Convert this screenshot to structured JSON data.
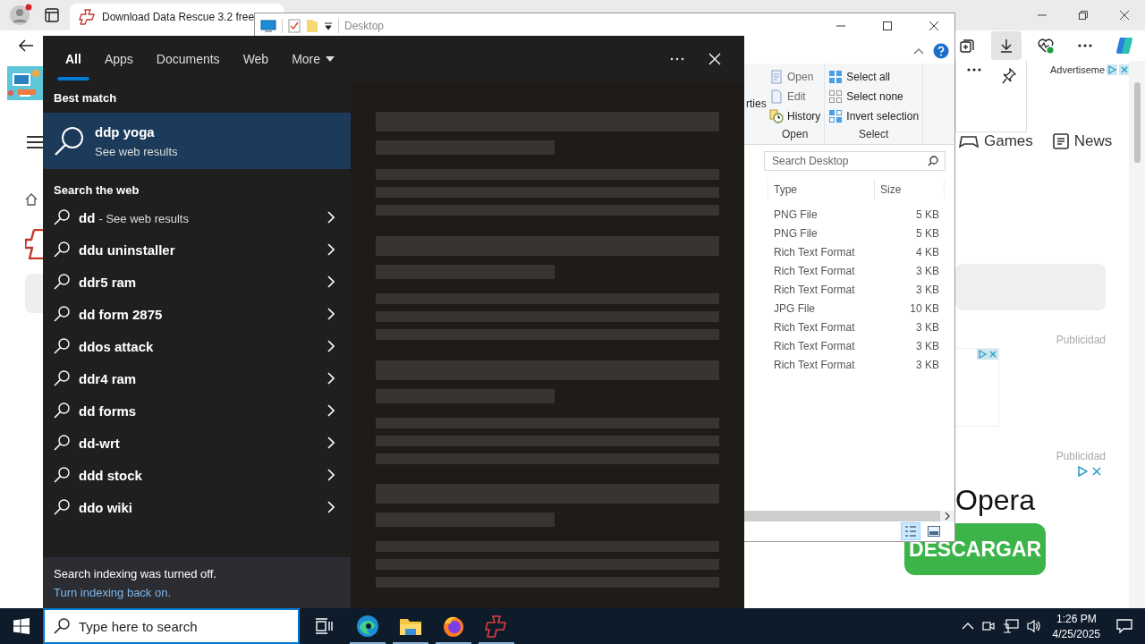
{
  "browser": {
    "tab": {
      "title": "Download Data Rescue 3.2 free"
    },
    "toolbar_buttons": [
      {
        "kind": "collections",
        "selected": false
      },
      {
        "kind": "downloads",
        "selected": true
      },
      {
        "kind": "health",
        "selected": false
      },
      {
        "kind": "more",
        "selected": false
      },
      {
        "kind": "copilot",
        "selected": false
      }
    ],
    "page": {
      "ad_label": "Advertiseme",
      "nav": [
        {
          "kind": "games",
          "label": "Games"
        },
        {
          "kind": "news",
          "label": "News"
        }
      ],
      "sponsor_labels": [
        "Publicidad",
        "Publicidad"
      ],
      "ad_brand": "Opera",
      "download_button": "DESCARGAR"
    }
  },
  "explorer": {
    "location": "Desktop",
    "ribbon": {
      "cut_label": "rties",
      "groups": [
        {
          "name": "Open",
          "items": [
            {
              "kind": "open",
              "label": "Open",
              "disabled": true
            },
            {
              "kind": "edit",
              "label": "Edit",
              "disabled": true
            },
            {
              "kind": "history",
              "label": "History",
              "disabled": false
            }
          ]
        },
        {
          "name": "Select",
          "items": [
            {
              "kind": "select-all",
              "label": "Select all",
              "disabled": false
            },
            {
              "kind": "select-none",
              "label": "Select none",
              "disabled": false
            },
            {
              "kind": "invert",
              "label": "Invert selection",
              "disabled": false
            }
          ]
        }
      ]
    },
    "search": {
      "placeholder": "Search Desktop"
    },
    "columns": [
      "Type",
      "Size"
    ],
    "rows": [
      {
        "type": "PNG File",
        "size": "5 KB"
      },
      {
        "type": "PNG File",
        "size": "5 KB"
      },
      {
        "type": "Rich Text Format",
        "size": "4 KB"
      },
      {
        "type": "Rich Text Format",
        "size": "3 KB"
      },
      {
        "type": "Rich Text Format",
        "size": "3 KB"
      },
      {
        "type": "JPG File",
        "size": "10 KB"
      },
      {
        "type": "Rich Text Format",
        "size": "3 KB"
      },
      {
        "type": "Rich Text Format",
        "size": "3 KB"
      },
      {
        "type": "Rich Text Format",
        "size": "3 KB"
      }
    ]
  },
  "search_panel": {
    "tabs": [
      {
        "label": "All",
        "selected": true,
        "dropdown": false
      },
      {
        "label": "Apps",
        "selected": false,
        "dropdown": false
      },
      {
        "label": "Documents",
        "selected": false,
        "dropdown": false
      },
      {
        "label": "Web",
        "selected": false,
        "dropdown": false
      },
      {
        "label": "More",
        "selected": false,
        "dropdown": true
      }
    ],
    "best_match": {
      "heading": "Best match",
      "title": "ddp yoga",
      "subtitle": "See web results"
    },
    "web_heading": "Search the web",
    "suggestions": [
      {
        "query": "dd",
        "hint": "- See web results"
      },
      {
        "query": "ddu uninstaller"
      },
      {
        "query": "ddr5 ram"
      },
      {
        "query": "dd form 2875"
      },
      {
        "query": "ddos attack"
      },
      {
        "query": "ddr4 ram"
      },
      {
        "query": "dd forms"
      },
      {
        "query": "dd-wrt"
      },
      {
        "query": "ddd stock"
      },
      {
        "query": "ddo wiki"
      }
    ],
    "notice": {
      "text": "Search indexing was turned off.",
      "link": "Turn indexing back on."
    }
  },
  "taskbar": {
    "search_placeholder": "Type here to search",
    "apps": [
      {
        "kind": "task-view",
        "running": false
      },
      {
        "kind": "edge",
        "running": true
      },
      {
        "kind": "explorer",
        "running": true
      },
      {
        "kind": "firefox",
        "running": true
      },
      {
        "kind": "cross-app",
        "running": true
      }
    ],
    "time": "1:26 PM",
    "date": "4/25/2025"
  }
}
